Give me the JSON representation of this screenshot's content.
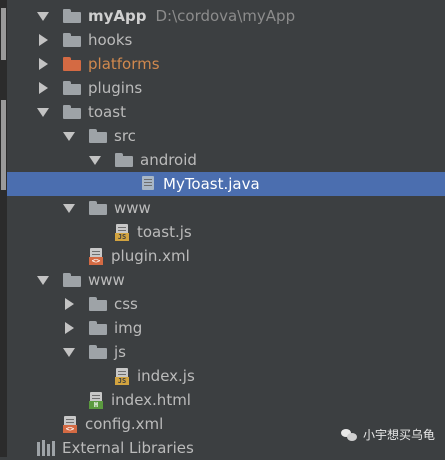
{
  "project": {
    "name": "myApp",
    "path": "D:\\cordova\\myApp"
  },
  "tree": [
    {
      "label": "hooks"
    },
    {
      "label": "platforms"
    },
    {
      "label": "plugins"
    },
    {
      "label": "toast"
    },
    {
      "label": "src"
    },
    {
      "label": "android"
    },
    {
      "label": "MyToast.java"
    },
    {
      "label": "www"
    },
    {
      "label": "toast.js"
    },
    {
      "label": "plugin.xml"
    },
    {
      "label": "www"
    },
    {
      "label": "css"
    },
    {
      "label": "img"
    },
    {
      "label": "js"
    },
    {
      "label": "index.js"
    },
    {
      "label": "index.html"
    },
    {
      "label": "config.xml"
    },
    {
      "label": "External Libraries"
    }
  ],
  "badges": {
    "js": "JS",
    "xml": "<>",
    "html": "H"
  },
  "colors": {
    "background": "#3c3f41",
    "selection": "#4b6eaf",
    "platforms_folder": "#d46a43",
    "text": "#bbbbbb"
  },
  "watermark": "小宇想买乌龟"
}
